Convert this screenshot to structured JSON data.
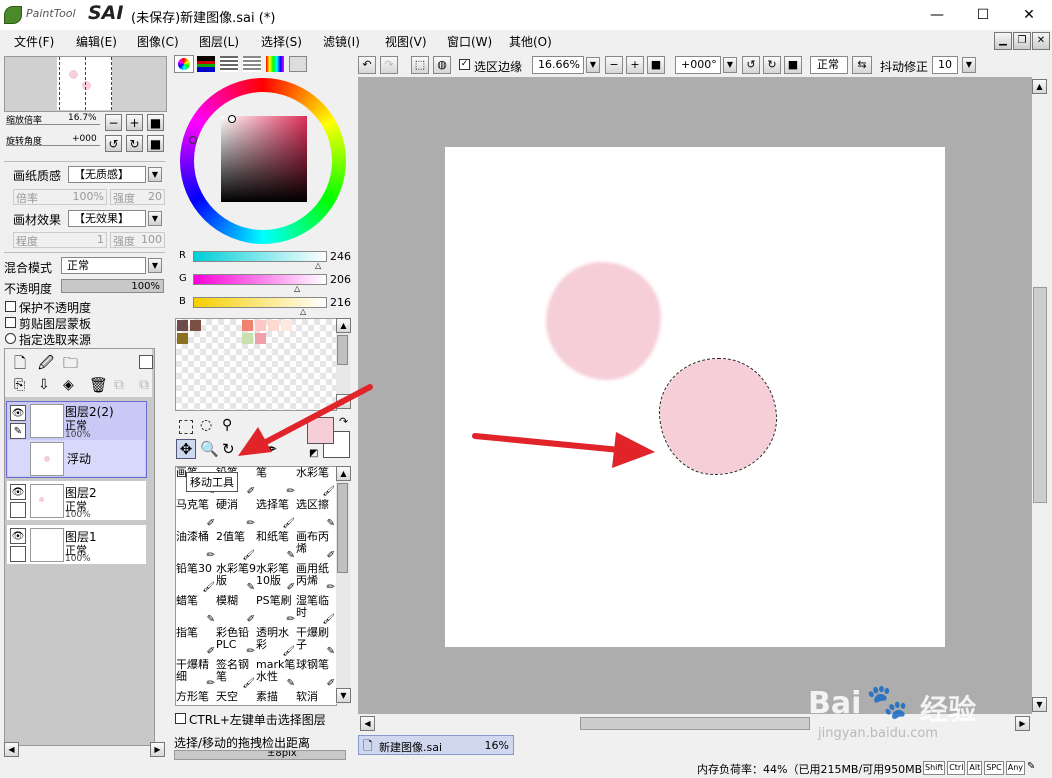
{
  "app": {
    "logo_text": "PaintTool",
    "logo_brand": "SAI",
    "title": "(未保存)新建图像.sai (*)"
  },
  "window_controls": {
    "minimize": "—",
    "maximize": "☐",
    "close": "✕"
  },
  "menu": [
    "文件(F)",
    "编辑(E)",
    "图像(C)",
    "图层(L)",
    "选择(S)",
    "滤镜(I)",
    "视图(V)",
    "窗口(W)",
    "其他(O)"
  ],
  "navigator": {
    "zoom_label": "缩放倍率",
    "zoom_value": "16.7%",
    "rotation_label": "旋转角度",
    "rotation_value": "+000"
  },
  "paper": {
    "texture_label": "画纸质感",
    "texture_value": "【无质感】",
    "scale_label": "倍率",
    "scale_value": "100%",
    "strength_label": "强度",
    "strength_value": "20",
    "effect_label": "画材效果",
    "effect_value": "【无效果】",
    "degree_label": "程度",
    "degree_value": "1",
    "strength2_label": "强度",
    "strength2_value": "100"
  },
  "layer_props": {
    "blend_label": "混合模式",
    "blend_value": "正常",
    "opacity_label": "不透明度",
    "opacity_value": "100%",
    "protect_opacity": "保护不透明度",
    "clip_group": "剪贴图层蒙板",
    "selection_source": "指定选取来源"
  },
  "layers": [
    {
      "name": "图层2(2)",
      "mode": "正常",
      "opacity": "100%",
      "sub": "浮动",
      "selected": true
    },
    {
      "name": "图层2",
      "mode": "正常",
      "opacity": "100%"
    },
    {
      "name": "图层1",
      "mode": "正常",
      "opacity": "100%"
    }
  ],
  "color": {
    "r_label": "R",
    "r_value": "246",
    "g_label": "G",
    "g_value": "206",
    "b_label": "B",
    "b_value": "216",
    "current": "#f6ced8",
    "swatches": [
      "#6e4a4a",
      "#7a5044",
      "#f08070",
      "#ffc8c8",
      "#ffd8d0",
      "#ffe8e0",
      "#8a7020",
      "#c8e0b0",
      "#f0a0a8"
    ]
  },
  "tooltip": "移动工具",
  "brushes": [
    [
      "画笔",
      "铅笔",
      "笔",
      "水彩笔"
    ],
    [
      "马克笔",
      "硬消",
      "选择笔",
      "选区擦"
    ],
    [
      "油漆桶",
      "2值笔",
      "和纸笔",
      "画布丙烯"
    ],
    [
      "铅笔30",
      "水彩笔9版",
      "水彩笔10版",
      "画用纸丙烯"
    ],
    [
      "蜡笔",
      "模糊",
      "PS笔刷",
      "湿笔临时"
    ],
    [
      "指笔",
      "彩色铅PLC",
      "透明水彩",
      "干爆刷子"
    ],
    [
      "干爆精细",
      "签名钢笔",
      "mark笔水性",
      "球钢笔"
    ],
    [
      "方形笔",
      "天空",
      "素描",
      "软消"
    ]
  ],
  "ctrl_select_label": "CTRL+左键单击选择图层",
  "drag_distance_label": "选择/移动的拖拽检出距离",
  "drag_distance_value": "±8pix",
  "toolbar": {
    "show_selection": "选区边缘",
    "zoom": "16.66%",
    "angle": "+000°",
    "blend": "正常",
    "stabilizer_label": "抖动修正",
    "stabilizer_value": "10"
  },
  "tab": {
    "name": "新建图像.sai",
    "zoom": "16%"
  },
  "status": {
    "memory": "内存负荷率：44%（已用215MB/可用950MB）",
    "keys": [
      "Shift",
      "Ctrl",
      "Alt",
      "SPC",
      "Any"
    ]
  },
  "watermark": {
    "brand": "Bai",
    "brand2": "经验",
    "url": "jingyan.baidu.com"
  }
}
